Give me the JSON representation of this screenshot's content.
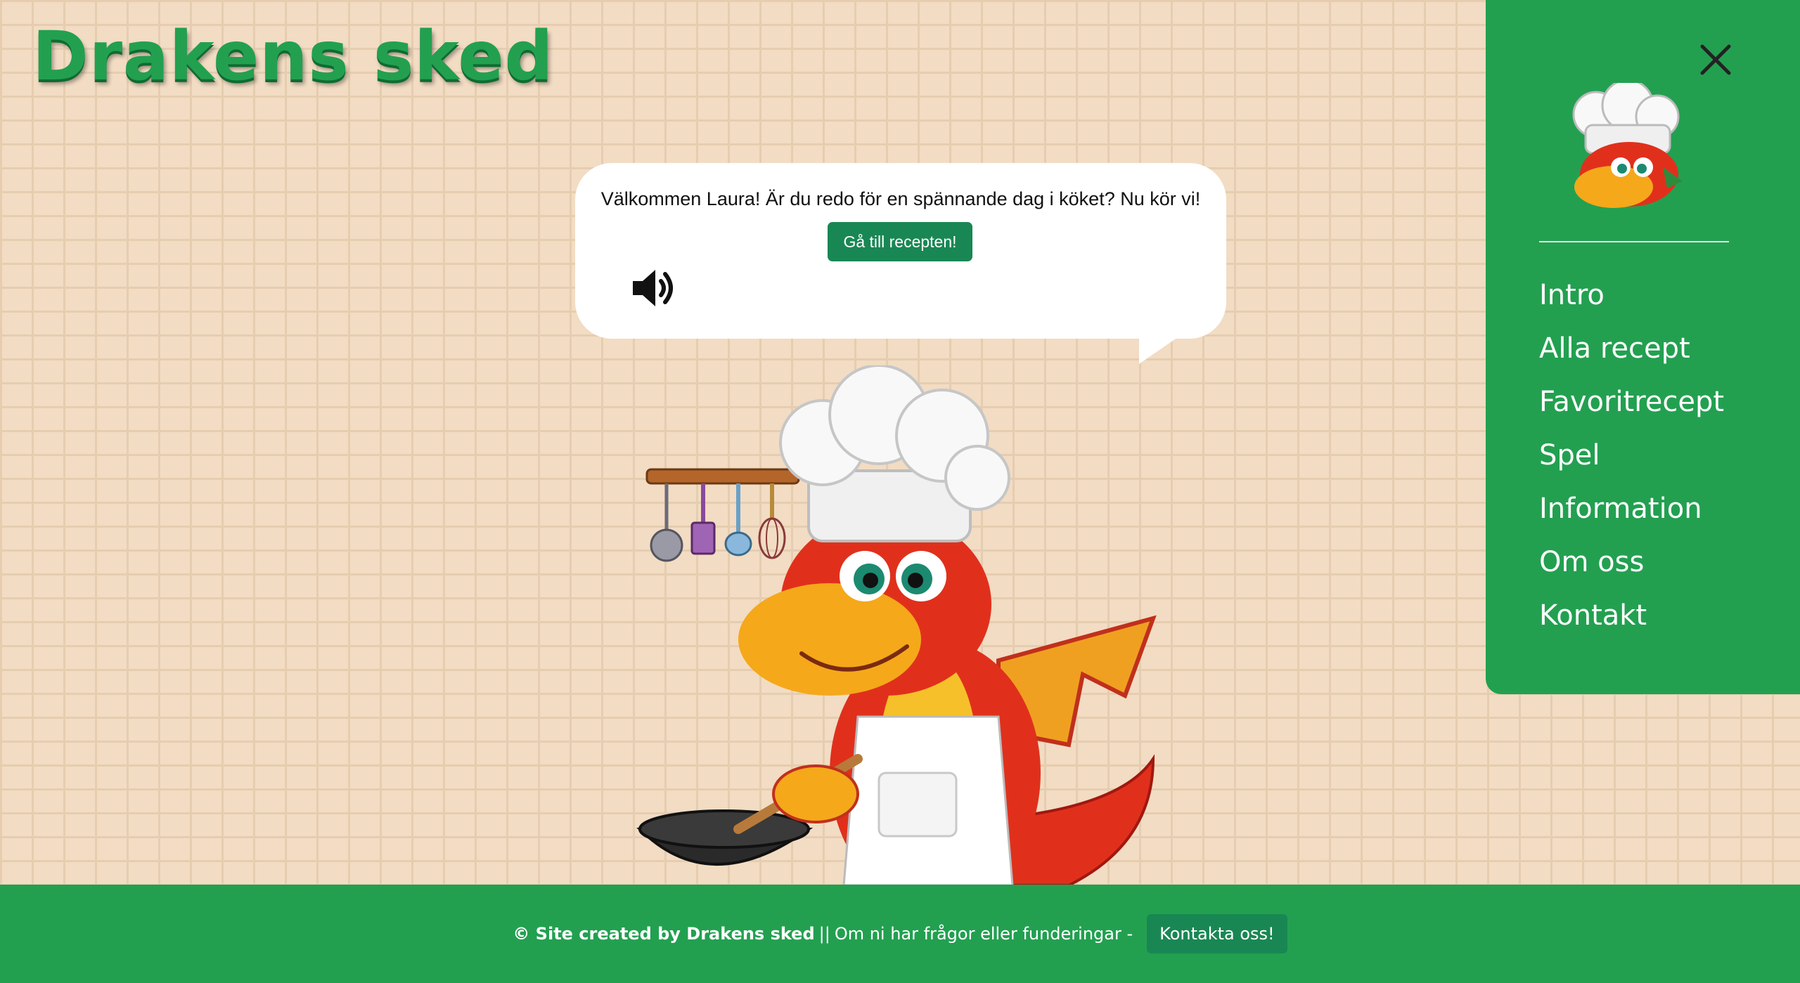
{
  "header": {
    "brand": "Drakens sked"
  },
  "bubble": {
    "greeting": "Välkommen Laura! Är du redo för en spännande dag i köket? Nu kör vi!",
    "recipe_button": "Gå till recepten!",
    "speaker_icon": "speaker-icon"
  },
  "sidebar": {
    "close_icon": "close-icon",
    "logo_icon": "dragon-chef-logo",
    "items": [
      {
        "label": "Intro"
      },
      {
        "label": "Alla recept"
      },
      {
        "label": "Favoritrecept"
      },
      {
        "label": "Spel"
      },
      {
        "label": "Information"
      },
      {
        "label": "Om oss"
      },
      {
        "label": "Kontakt"
      }
    ]
  },
  "footer": {
    "credit": "© Site created by Drakens sked",
    "separator": "||",
    "message": "Om ni har frågor eller funderingar -",
    "contact_button": "Kontakta oss!"
  },
  "colors": {
    "brand_green": "#22a050",
    "button_green": "#198754",
    "wall": "#f2dcc3"
  }
}
